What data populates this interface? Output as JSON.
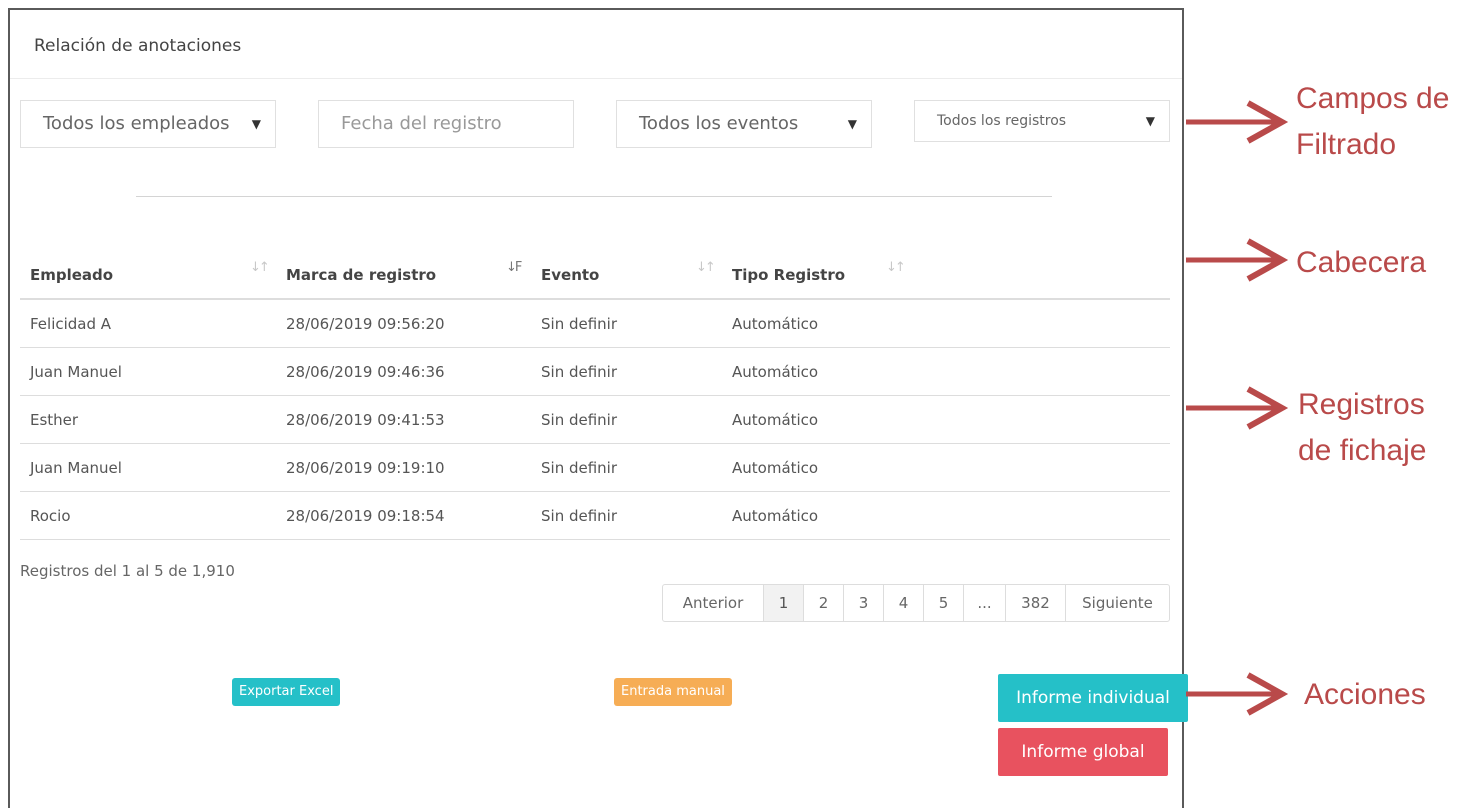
{
  "panel": {
    "title": "Relación de anotaciones"
  },
  "filters": {
    "employees": "Todos los empleados",
    "date_placeholder": "Fecha del registro",
    "events": "Todos los eventos",
    "records": "Todos los registros",
    "caret": "▼"
  },
  "table": {
    "columns": [
      "Empleado",
      "Marca de registro",
      "Evento",
      "Tipo Registro"
    ],
    "sort_icon": "↓↑",
    "sort_icon_active": "↓F",
    "rows": [
      [
        "Felicidad A",
        "28/06/2019 09:56:20",
        "Sin definir",
        "Automático"
      ],
      [
        "Juan Manuel",
        "28/06/2019 09:46:36",
        "Sin definir",
        "Automático"
      ],
      [
        "Esther",
        "28/06/2019 09:41:53",
        "Sin definir",
        "Automático"
      ],
      [
        "Juan Manuel",
        "28/06/2019 09:19:10",
        "Sin definir",
        "Automático"
      ],
      [
        "Rocio",
        "28/06/2019 09:18:54",
        "Sin definir",
        "Automático"
      ]
    ],
    "info": "Registros del 1 al 5 de 1,910"
  },
  "pagination": {
    "prev": "Anterior",
    "pages": [
      "1",
      "2",
      "3",
      "4",
      "5",
      "...",
      "382"
    ],
    "current": "1",
    "next": "Siguiente"
  },
  "actions": {
    "export_excel": "Exportar Excel",
    "manual_entry": "Entrada manual",
    "individual_report": "Informe individual",
    "global_report": "Informe global"
  },
  "colors": {
    "teal": "#25c0c8",
    "orange": "#f6ad55",
    "red": "#e8525f",
    "annotation": "#b94a4a"
  },
  "annotations": {
    "filters_line1": "Campos de",
    "filters_line2": "Filtrado",
    "header": "Cabecera",
    "records_line1": "Registros",
    "records_line2": "de fichaje",
    "actions": "Acciones"
  }
}
